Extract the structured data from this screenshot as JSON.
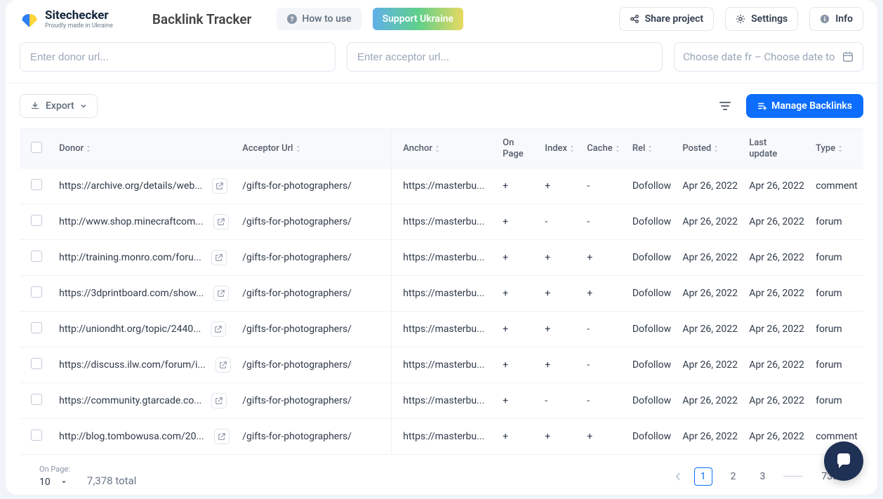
{
  "brand": {
    "name": "Sitechecker",
    "tagline": "Proudly made in Ukraine"
  },
  "page_title": "Backlink Tracker",
  "topbar": {
    "how_to_use": "How to use",
    "support": "Support Ukraine",
    "share": "Share project",
    "settings": "Settings",
    "info": "Info"
  },
  "filters": {
    "donor_placeholder": "Enter donor url...",
    "acceptor_placeholder": "Enter acceptor url...",
    "date_from": "Choose date fr",
    "date_to": "Choose date to"
  },
  "toolbar": {
    "export": "Export",
    "manage": "Manage Backlinks"
  },
  "table": {
    "headers": {
      "donor": "Donor",
      "acceptor": "Acceptor Url",
      "anchor": "Anchor",
      "onpage1": "On",
      "onpage2": "Page",
      "index": "Index",
      "cache": "Cache",
      "rel": "Rel",
      "posted": "Posted",
      "last1": "Last",
      "last2": "update",
      "type": "Type"
    },
    "rows": [
      {
        "donor": "https://archive.org/details/web...",
        "acceptor": "/gifts-for-photographers/",
        "anchor": "https://masterbu...",
        "onpage": "+",
        "index": "+",
        "cache": "-",
        "rel": "Dofollow",
        "posted": "Apr 26, 2022",
        "last": "Apr 26, 2022",
        "type": "comment"
      },
      {
        "donor": "http://www.shop.minecraftcom...",
        "acceptor": "/gifts-for-photographers/",
        "anchor": "https://masterbu...",
        "onpage": "+",
        "index": "-",
        "cache": "-",
        "rel": "Dofollow",
        "posted": "Apr 26, 2022",
        "last": "Apr 26, 2022",
        "type": "forum"
      },
      {
        "donor": "http://training.monro.com/foru...",
        "acceptor": "/gifts-for-photographers/",
        "anchor": "https://masterbu...",
        "onpage": "+",
        "index": "+",
        "cache": "+",
        "rel": "Dofollow",
        "posted": "Apr 26, 2022",
        "last": "Apr 26, 2022",
        "type": "forum"
      },
      {
        "donor": "https://3dprintboard.com/show...",
        "acceptor": "/gifts-for-photographers/",
        "anchor": "https://masterbu...",
        "onpage": "+",
        "index": "+",
        "cache": "+",
        "rel": "Dofollow",
        "posted": "Apr 26, 2022",
        "last": "Apr 26, 2022",
        "type": "forum"
      },
      {
        "donor": "http://uniondht.org/topic/2440...",
        "acceptor": "/gifts-for-photographers/",
        "anchor": "https://masterbu...",
        "onpage": "+",
        "index": "+",
        "cache": "-",
        "rel": "Dofollow",
        "posted": "Apr 26, 2022",
        "last": "Apr 26, 2022",
        "type": "forum"
      },
      {
        "donor": "https://discuss.ilw.com/forum/i...",
        "acceptor": "/gifts-for-photographers/",
        "anchor": "https://masterbu...",
        "onpage": "+",
        "index": "+",
        "cache": "-",
        "rel": "Dofollow",
        "posted": "Apr 26, 2022",
        "last": "Apr 26, 2022",
        "type": "forum"
      },
      {
        "donor": "https://community.gtarcade.co...",
        "acceptor": "/gifts-for-photographers/",
        "anchor": "https://masterbu...",
        "onpage": "+",
        "index": "-",
        "cache": "-",
        "rel": "Dofollow",
        "posted": "Apr 26, 2022",
        "last": "Apr 26, 2022",
        "type": "forum"
      },
      {
        "donor": "http://blog.tombowusa.com/20...",
        "acceptor": "/gifts-for-photographers/",
        "anchor": "https://masterbu...",
        "onpage": "+",
        "index": "+",
        "cache": "+",
        "rel": "Dofollow",
        "posted": "Apr 26, 2022",
        "last": "Apr 26, 2022",
        "type": "comment"
      }
    ]
  },
  "footer": {
    "onpage_label": "On Page:",
    "onpage_value": "10",
    "total": "7,378 total",
    "pages": [
      "1",
      "2",
      "3",
      "738"
    ]
  }
}
